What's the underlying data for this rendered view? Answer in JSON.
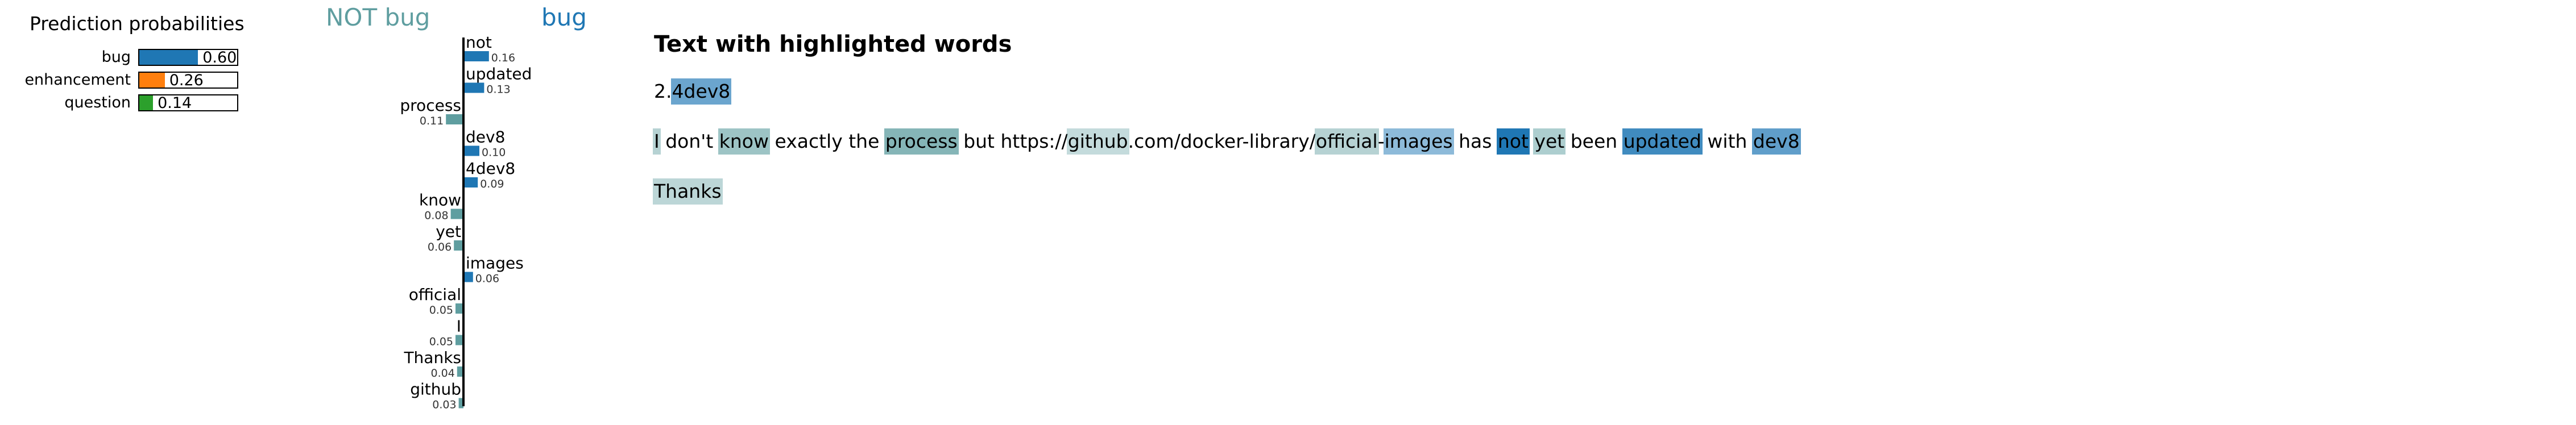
{
  "probabilities": {
    "title": "Prediction probabilities",
    "items": [
      {
        "label": "bug",
        "value": 0.6,
        "value_text": "0.60",
        "color": "#1f77b4"
      },
      {
        "label": "enhancement",
        "value": 0.26,
        "value_text": "0.26",
        "color": "#ff7f0e"
      },
      {
        "label": "question",
        "value": 0.14,
        "value_text": "0.14",
        "color": "#2ca02c"
      }
    ]
  },
  "explanation": {
    "left_heading": "NOT bug",
    "right_heading": "bug",
    "positive_color": "#1f77b4",
    "negative_color": "#5f9ea0",
    "chart_data": {
      "type": "bar",
      "orientation": "horizontal",
      "categories": [
        "not",
        "updated",
        "process",
        "dev8",
        "4dev8",
        "know",
        "yet",
        "images",
        "official",
        "I",
        "Thanks",
        "github"
      ],
      "values": [
        0.16,
        0.13,
        -0.11,
        0.1,
        0.09,
        -0.08,
        -0.06,
        0.06,
        -0.05,
        -0.05,
        -0.04,
        -0.03
      ],
      "value_labels": [
        "0.16",
        "0.13",
        "0.11",
        "0.10",
        "0.09",
        "0.08",
        "0.06",
        "0.06",
        "0.05",
        "0.05",
        "0.04",
        "0.03"
      ]
    }
  },
  "highlighted_text": {
    "title": "Text with highlighted words",
    "lines": [
      [
        {
          "t": "2.",
          "w": 0
        },
        {
          "t": "4dev8",
          "w": 0.09
        }
      ],
      [
        {
          "t": "I",
          "w": -0.05
        },
        {
          "t": " don't ",
          "w": 0
        },
        {
          "t": "know",
          "w": -0.08
        },
        {
          "t": " exactly the ",
          "w": 0
        },
        {
          "t": "process",
          "w": -0.11
        },
        {
          "t": " but https://",
          "w": 0
        },
        {
          "t": "github",
          "w": -0.03
        },
        {
          "t": ".com/docker-library/",
          "w": 0
        },
        {
          "t": "official",
          "w": -0.05
        },
        {
          "t": "-",
          "w": 0
        },
        {
          "t": "images",
          "w": 0.06
        },
        {
          "t": " has ",
          "w": 0
        },
        {
          "t": "not",
          "w": 0.16
        },
        {
          "t": " ",
          "w": 0
        },
        {
          "t": "yet",
          "w": -0.06
        },
        {
          "t": " been ",
          "w": 0
        },
        {
          "t": "updated",
          "w": 0.13
        },
        {
          "t": " with ",
          "w": 0
        },
        {
          "t": "dev8",
          "w": 0.1
        }
      ],
      [
        {
          "t": "Thanks",
          "w": -0.04
        }
      ]
    ]
  }
}
